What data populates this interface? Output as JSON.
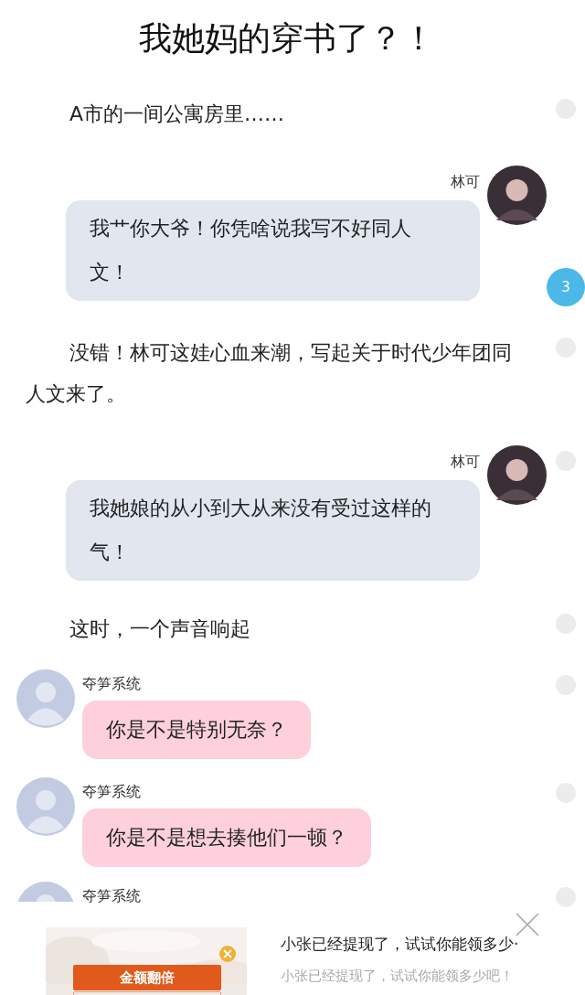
{
  "title": "我她妈的穿书了？！",
  "blocks": [
    {
      "kind": "narration",
      "text": "A市的一间公寓房里……",
      "marker": {
        "kind": "dot"
      }
    },
    {
      "kind": "outgoing",
      "sender": "林可",
      "text": "我艹你大爷！你凭啥说我写不好同人文！",
      "marker": {
        "kind": "badge",
        "count": "3"
      }
    },
    {
      "kind": "narration",
      "text": "没错！林可这娃心血来潮，写起关于时代少年团同人文来了。",
      "marker": {
        "kind": "dot"
      }
    },
    {
      "kind": "outgoing",
      "sender": "林可",
      "text": "我她娘的从小到大从来没有受过这样的气！",
      "marker": {
        "kind": "dot"
      }
    },
    {
      "kind": "narration",
      "text": "这时，一个声音响起",
      "marker": {
        "kind": "dot"
      }
    },
    {
      "kind": "incoming",
      "sender": "夺笋系统",
      "text": "你是不是特别无奈？",
      "marker": {
        "kind": "dot"
      }
    },
    {
      "kind": "incoming",
      "sender": "夺笋系统",
      "text": "你是不是想去揍他们一顿？",
      "marker": {
        "kind": "dot"
      }
    },
    {
      "kind": "incoming",
      "sender": "夺笋系统",
      "marker": {
        "kind": "dot"
      }
    }
  ],
  "ad": {
    "button": "金额翻倍",
    "headline": "小张已经提现了，试试你能领多少·",
    "subtitle": "小张已经提现了，试试你能领多少吧！"
  }
}
